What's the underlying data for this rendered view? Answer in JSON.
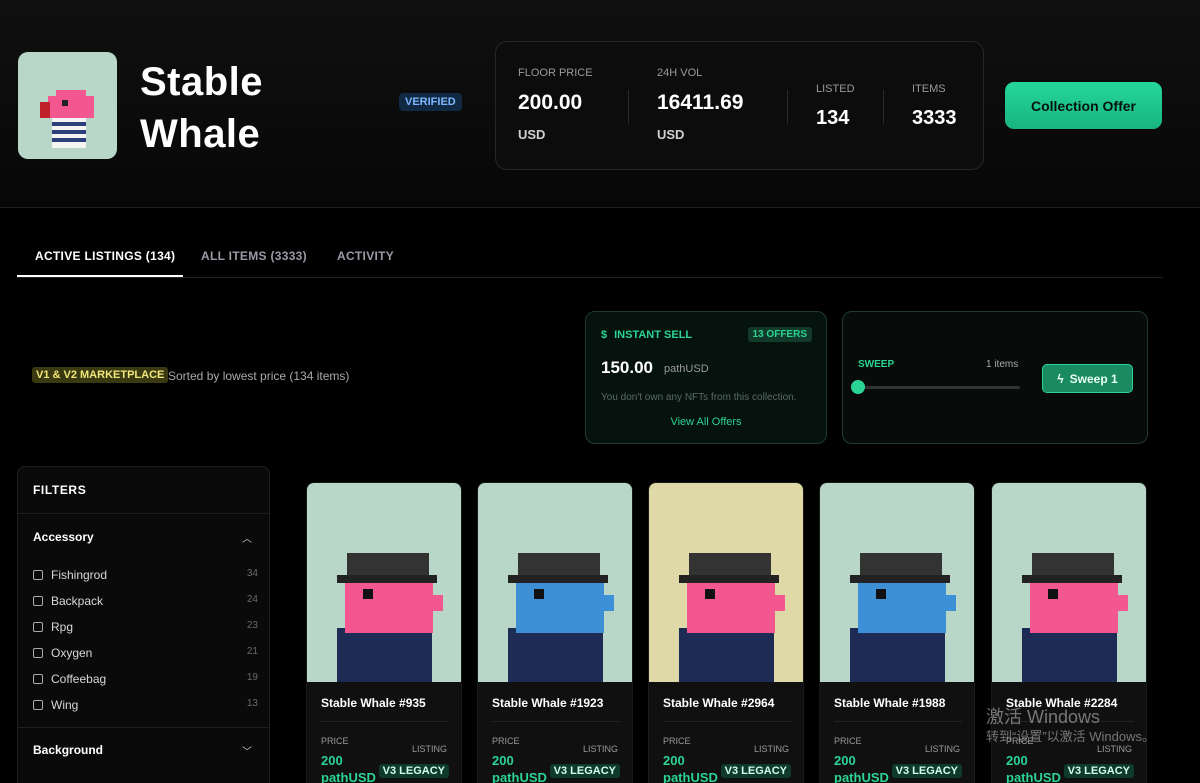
{
  "collection": {
    "title_line1": "Stable",
    "title_line2": "Whale",
    "verified": "VERIFIED"
  },
  "stats": {
    "floor_label": "FLOOR PRICE",
    "floor_value": "200.00",
    "floor_unit": "USD",
    "vol_label": "24H VOL",
    "vol_value": "16411.69",
    "vol_unit": "USD",
    "listed_label": "LISTED",
    "listed_value": "134",
    "items_label": "ITEMS",
    "items_value": "3333"
  },
  "offer_button": "Collection Offer",
  "tabs": [
    {
      "label": "ACTIVE LISTINGS (134)",
      "active": true
    },
    {
      "label": "ALL ITEMS (3333)",
      "active": false
    },
    {
      "label": "ACTIVITY",
      "active": false
    }
  ],
  "marketplace": {
    "tag": "V1 & V2 MARKETPLACE",
    "sort_text": "Sorted by lowest price (134 items)"
  },
  "instant_sell": {
    "title": "INSTANT SELL",
    "offers_badge": "13 OFFERS",
    "price": "150.00",
    "price_unit": "pathUSD",
    "note": "You don't own any NFTs from this collection.",
    "link": "View All Offers"
  },
  "sweep": {
    "label": "SWEEP",
    "count": "1 items",
    "button": "Sweep 1",
    "level": 0
  },
  "filters": {
    "title": "FILTERS",
    "sections": [
      {
        "name": "Accessory",
        "expanded": true,
        "items": [
          {
            "name": "Fishingrod",
            "count": "34"
          },
          {
            "name": "Backpack",
            "count": "24"
          },
          {
            "name": "Rpg",
            "count": "23"
          },
          {
            "name": "Oxygen",
            "count": "21"
          },
          {
            "name": "Coffeebag",
            "count": "19"
          },
          {
            "name": "Wing",
            "count": "13"
          }
        ]
      },
      {
        "name": "Background",
        "expanded": false,
        "items": []
      }
    ]
  },
  "cards": [
    {
      "name": "Stable Whale #935",
      "price_label": "PRICE",
      "price": "200",
      "currency": "pathUSD",
      "listing_label": "LISTING",
      "listing": "V3 LEGACY",
      "bg": "#b9d7c9",
      "whale": "#f2578f"
    },
    {
      "name": "Stable Whale #1923",
      "price_label": "PRICE",
      "price": "200",
      "currency": "pathUSD",
      "listing_label": "LISTING",
      "listing": "V3 LEGACY",
      "bg": "#b9d7c9",
      "whale": "#3d8fd6"
    },
    {
      "name": "Stable Whale #2964",
      "price_label": "PRICE",
      "price": "200",
      "currency": "pathUSD",
      "listing_label": "LISTING",
      "listing": "V3 LEGACY",
      "bg": "#ded9a6",
      "whale": "#f2578f"
    },
    {
      "name": "Stable Whale #1988",
      "price_label": "PRICE",
      "price": "200",
      "currency": "pathUSD",
      "listing_label": "LISTING",
      "listing": "V3 LEGACY",
      "bg": "#b9d7c9",
      "whale": "#3d8fd6"
    },
    {
      "name": "Stable Whale #2284",
      "price_label": "PRICE",
      "price": "200",
      "currency": "pathUSD",
      "listing_label": "LISTING",
      "listing": "V3 LEGACY",
      "bg": "#b9d7c9",
      "whale": "#f2578f"
    }
  ],
  "watermark": {
    "line1": "激活 Windows",
    "line2": "转到“设置”以激活 Windows。"
  }
}
